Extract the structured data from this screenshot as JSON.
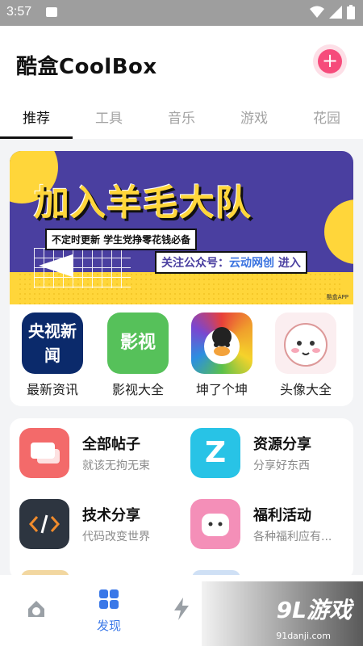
{
  "status_bar": {
    "time": "3:57"
  },
  "header": {
    "title": "酷盒CoolBox",
    "add_symbol": "+"
  },
  "tabs": [
    "推荐",
    "工具",
    "音乐",
    "游戏",
    "花园"
  ],
  "banner": {
    "headline": "加入羊毛大队",
    "subline": "不定时更新 学生党挣零花钱必备",
    "follow_prefix": "关注公众号：",
    "follow_name": "云动网创",
    "follow_suffix": " 进入",
    "ad_tag": "酷盒APP"
  },
  "apps": [
    {
      "label": "最新资讯",
      "color": "#0b2a6b",
      "icon_text": "央视新闻"
    },
    {
      "label": "影视大全",
      "color": "#56c15a",
      "icon_text": "影视"
    },
    {
      "label": "坤了个坤",
      "color": "#2c64c9",
      "icon_text": ""
    },
    {
      "label": "头像大全",
      "color": "#fbeef0",
      "icon_text": ""
    }
  ],
  "features": [
    {
      "title": "全部帖子",
      "subtitle": "就该无拘无束",
      "color": "#f36a6a",
      "icon": "chat-bubbles-icon"
    },
    {
      "title": "资源分享",
      "subtitle": "分享好东西",
      "color": "#28c3e6",
      "icon": "z-logo-icon"
    },
    {
      "title": "技术分享",
      "subtitle": "代码改变世界",
      "color": "#2d3540",
      "icon": "code-icon"
    },
    {
      "title": "福利活动",
      "subtitle": "各种福利应有...",
      "color": "#f48fb8",
      "icon": "cute-face-icon"
    }
  ],
  "bottom_nav": {
    "discover_label": "发现"
  },
  "watermark": {
    "text": "9L游戏",
    "url": "91danji.com"
  }
}
